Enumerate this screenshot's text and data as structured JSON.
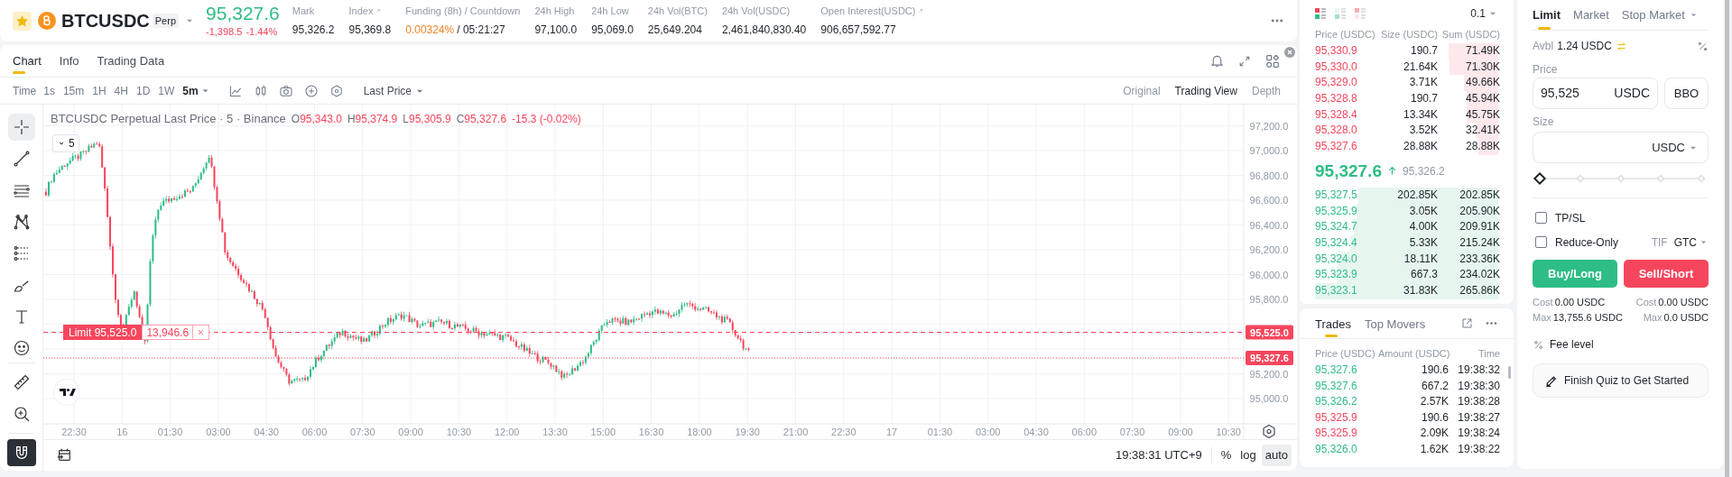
{
  "header": {
    "favorite": true,
    "symbol": "BTCUSDC",
    "contract_tag": "Perp",
    "last_price": "95,327.6",
    "change": "-1,398.5",
    "change_pct": "-1.44%",
    "stats": [
      {
        "label": "Mark",
        "value": "95,326.2",
        "link_icon": false,
        "highlight": false
      },
      {
        "label": "Index",
        "value": "95,369.8",
        "link_icon": true,
        "highlight": false
      },
      {
        "label": "Funding (8h) / Countdown",
        "value": "0.00324%",
        "extra": "/ 05:21:27",
        "link_icon": false,
        "highlight": true
      },
      {
        "label": "24h High",
        "value": "97,100.0",
        "link_icon": false,
        "highlight": false
      },
      {
        "label": "24h Low",
        "value": "95,069.0",
        "link_icon": false,
        "highlight": false
      },
      {
        "label": "24h Vol(BTC)",
        "value": "25,649.204",
        "link_icon": false,
        "highlight": false
      },
      {
        "label": "24h Vol(USDC)",
        "value": "2,461,840,830.40",
        "link_icon": false,
        "highlight": false
      },
      {
        "label": "Open Interest(USDC)",
        "value": "906,657,592.77",
        "link_icon": true,
        "highlight": false
      }
    ]
  },
  "chart_panel": {
    "tabs": [
      {
        "label": "Chart",
        "selected": true
      },
      {
        "label": "Info",
        "selected": false
      },
      {
        "label": "Trading Data",
        "selected": false
      }
    ],
    "toolbar": {
      "time_label": "Time",
      "intervals": [
        {
          "label": "1s",
          "selected": false
        },
        {
          "label": "15m",
          "selected": false
        },
        {
          "label": "1H",
          "selected": false
        },
        {
          "label": "4H",
          "selected": false
        },
        {
          "label": "1D",
          "selected": false
        },
        {
          "label": "1W",
          "selected": false
        },
        {
          "label": "5m",
          "selected": true
        }
      ],
      "price_source": "Last Price",
      "views": [
        {
          "label": "Original",
          "selected": false
        },
        {
          "label": "Trading View",
          "selected": true
        },
        {
          "label": "Depth",
          "selected": false
        }
      ]
    },
    "tools": [
      {
        "kind": "crosshair",
        "selected": true
      },
      {
        "kind": "trend",
        "selected": false
      },
      {
        "kind": "lines",
        "selected": false
      },
      {
        "kind": "pattern",
        "selected": false
      },
      {
        "kind": "fib",
        "selected": false
      },
      {
        "kind": "brush",
        "selected": false
      },
      {
        "kind": "text",
        "selected": false
      },
      {
        "kind": "emoji",
        "selected": false
      },
      {
        "kind": "ruler",
        "selected": false
      },
      {
        "kind": "zoom",
        "selected": false
      }
    ],
    "magnet": {
      "on": true
    },
    "chart": {
      "legend": {
        "title": "BTCUSDC Perpetual Last Price · 5 · Binance",
        "ohlc": [
          {
            "key": "O",
            "value": "95,343.0"
          },
          {
            "key": "H",
            "value": "95,374.9"
          },
          {
            "key": "L",
            "value": "95,305.9"
          },
          {
            "key": "C",
            "value": "95,327.6"
          }
        ],
        "change": "-15.3 (-0.02%)"
      },
      "interval_toggle": "5",
      "price_axis": [
        "97,200.0",
        "97,000.0",
        "96,800.0",
        "96,600.0",
        "96,400.0",
        "96,200.0",
        "96,000.0",
        "95,800.0",
        "95,200.0",
        "95,000.0"
      ],
      "time_axis": [
        "22:30",
        "16",
        "01:30",
        "03:00",
        "04:30",
        "06:00",
        "07:30",
        "09:00",
        "10:30",
        "12:00",
        "13:30",
        "15:00",
        "16:30",
        "18:00",
        "19:30",
        "21:00",
        "22:30",
        "17",
        "01:30",
        "03:00",
        "04:30",
        "06:00",
        "07:30",
        "09:00",
        "10:30"
      ],
      "order_line": {
        "label": "Limit 95,525.0",
        "quantity": "13,946.6"
      },
      "price_badges": [
        "95,525.0",
        "95,327.6"
      ]
    },
    "bottom_bar": {
      "clock": "19:38:31 UTC+9",
      "scale_options": [
        {
          "label": "%",
          "selected": false
        },
        {
          "label": "log",
          "selected": false
        },
        {
          "label": "auto",
          "selected": true
        }
      ]
    }
  },
  "order_book": {
    "views": [
      {
        "kind": "both",
        "selected": true
      },
      {
        "kind": "bids",
        "selected": false
      },
      {
        "kind": "asks",
        "selected": false
      }
    ],
    "tick": "0.1",
    "columns": [
      "Price (USDC)",
      "Size (USDC)",
      "Sum (USDC)"
    ],
    "asks": [
      {
        "price": "95,330.9",
        "size": "190.7",
        "sum": "71.49K"
      },
      {
        "price": "95,330.0",
        "size": "21.64K",
        "sum": "71.30K"
      },
      {
        "price": "95,329.0",
        "size": "3.71K",
        "sum": "49.66K"
      },
      {
        "price": "95,328.8",
        "size": "190.7",
        "sum": "45.94K"
      },
      {
        "price": "95,328.4",
        "size": "13.34K",
        "sum": "45.75K"
      },
      {
        "price": "95,328.0",
        "size": "3.52K",
        "sum": "32.41K"
      },
      {
        "price": "95,327.6",
        "size": "28.88K",
        "sum": "28.88K"
      }
    ],
    "mid": {
      "price": "95,327.6",
      "rising": true,
      "mark": "95,326.2"
    },
    "bids": [
      {
        "price": "95,327.5",
        "size": "202.85K",
        "sum": "202.85K"
      },
      {
        "price": "95,325.9",
        "size": "3.05K",
        "sum": "205.90K"
      },
      {
        "price": "95,324.7",
        "size": "4.00K",
        "sum": "209.91K"
      },
      {
        "price": "95,324.4",
        "size": "5.33K",
        "sum": "215.24K"
      },
      {
        "price": "95,324.0",
        "size": "18.11K",
        "sum": "233.36K"
      },
      {
        "price": "95,323.9",
        "size": "667.3",
        "sum": "234.02K"
      },
      {
        "price": "95,323.1",
        "size": "31.83K",
        "sum": "265.86K"
      }
    ]
  },
  "trades": {
    "tabs": [
      {
        "label": "Trades",
        "selected": true
      },
      {
        "label": "Top Movers",
        "selected": false
      }
    ],
    "columns": [
      "Price (USDC)",
      "Amount (USDC)",
      "Time"
    ],
    "rows": [
      {
        "price": "95,327.6",
        "amount": "190.6",
        "time": "19:38:32",
        "color": "#2ebd85"
      },
      {
        "price": "95,327.6",
        "amount": "667.2",
        "time": "19:38:30",
        "color": "#2ebd85"
      },
      {
        "price": "95,326.2",
        "amount": "2.57K",
        "time": "19:38:28",
        "color": "#2ebd85"
      },
      {
        "price": "95,325.9",
        "amount": "190.6",
        "time": "19:38:27",
        "color": "#f6465d"
      },
      {
        "price": "95,325.9",
        "amount": "2.09K",
        "time": "19:38:24",
        "color": "#f6465d"
      },
      {
        "price": "95,326.0",
        "amount": "1.62K",
        "time": "19:38:22",
        "color": "#2ebd85"
      }
    ]
  },
  "order_form": {
    "tabs": [
      {
        "label": "Limit",
        "selected": true
      },
      {
        "label": "Market",
        "selected": false
      },
      {
        "label": "Stop Market",
        "selected": false
      }
    ],
    "available": {
      "label": "Avbl",
      "value": "1.24 USDC"
    },
    "price": {
      "label": "Price",
      "value": "95,525",
      "unit": "USDC"
    },
    "bbo": "BBO",
    "size": {
      "label": "Size",
      "unit": "USDC"
    },
    "slider": {
      "level": 0
    },
    "options": [
      {
        "label": "TP/SL",
        "checked": false
      },
      {
        "label": "Reduce-Only",
        "checked": false
      }
    ],
    "tif": {
      "label": "TIF",
      "value": "GTC"
    },
    "buy": "Buy/Long",
    "sell": "Sell/Short",
    "buy_info": [
      {
        "label": "Cost",
        "value": "0.00 USDC"
      },
      {
        "label": "Max",
        "value": "13,755.6 USDC"
      }
    ],
    "sell_info": [
      {
        "label": "Cost",
        "value": "0.00 USDC"
      },
      {
        "label": "Max",
        "value": "0.0 USDC"
      }
    ],
    "fee": "Fee level",
    "quiz": "Finish Quiz to Get Started"
  }
}
